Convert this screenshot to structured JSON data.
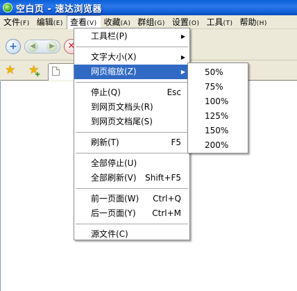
{
  "window": {
    "title": "空白页 - 速达浏览器"
  },
  "menubar": {
    "items": [
      {
        "label": "文件",
        "accel": "(F)"
      },
      {
        "label": "编辑",
        "accel": "(E)"
      },
      {
        "label": "查看",
        "accel": "(V)"
      },
      {
        "label": "收藏",
        "accel": "(A)"
      },
      {
        "label": "群组",
        "accel": "(G)"
      },
      {
        "label": "设置",
        "accel": "(O)"
      },
      {
        "label": "工具",
        "accel": "(T)"
      },
      {
        "label": "帮助",
        "accel": "(H)"
      }
    ]
  },
  "toolbar": {
    "icons": [
      "add-tab-icon",
      "back-icon",
      "forward-icon",
      "stop-icon"
    ],
    "add_glyph": "+",
    "stop_glyph": "✕"
  },
  "view_menu": {
    "toolbar": "工具栏(P)",
    "font_size": "文字大小(X)",
    "zoom": "网页缩放(Z)",
    "stop": "停止(Q)",
    "stop_shortcut": "Esc",
    "doc_top": "到网页文档头(R)",
    "doc_bottom": "到网页文档尾(S)",
    "refresh": "刷新(T)",
    "refresh_shortcut": "F5",
    "stop_all": "全部停止(U)",
    "refresh_all": "全部刷新(V)",
    "refresh_all_shortcut": "Shift+F5",
    "prev_page": "前一页面(W)",
    "prev_page_shortcut": "Ctrl+Q",
    "next_page": "后一页面(Y)",
    "next_page_shortcut": "Ctrl+M",
    "source": "源文件(C)",
    "submenu_arrow": "▶"
  },
  "zoom_submenu": {
    "options": [
      "50%",
      "75%",
      "100%",
      "125%",
      "150%",
      "200%"
    ]
  },
  "colors": {
    "titlebar": "#0a5fd8",
    "menu_highlight": "#316ac5",
    "menubar_bg": "#ece9d8"
  }
}
